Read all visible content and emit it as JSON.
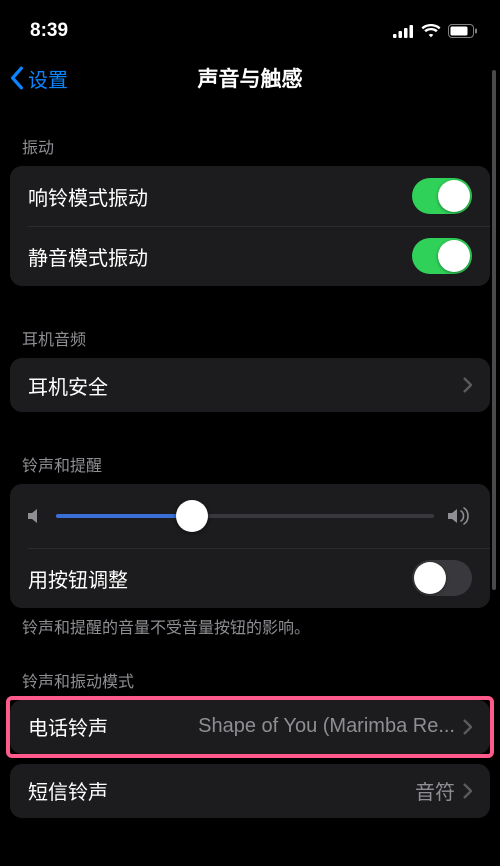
{
  "status": {
    "time": "8:39"
  },
  "nav": {
    "back": "设置",
    "title": "声音与触感"
  },
  "sections": {
    "vibrate": {
      "header": "振动",
      "vibrate_on_ring": {
        "label": "响铃模式振动",
        "on": true
      },
      "vibrate_on_silent": {
        "label": "静音模式振动",
        "on": true
      }
    },
    "headphone": {
      "header": "耳机音频",
      "safety": {
        "label": "耳机安全"
      }
    },
    "ringer": {
      "header": "铃声和提醒",
      "volume_pct": 36,
      "change_with_buttons": {
        "label": "用按钮调整",
        "on": false
      },
      "footer": "铃声和提醒的音量不受音量按钮的影响。"
    },
    "patterns": {
      "header": "铃声和振动模式",
      "ringtone": {
        "label": "电话铃声",
        "value": "Shape of You (Marimba Re..."
      },
      "text_tone": {
        "label": "短信铃声",
        "value": "音符"
      }
    }
  }
}
